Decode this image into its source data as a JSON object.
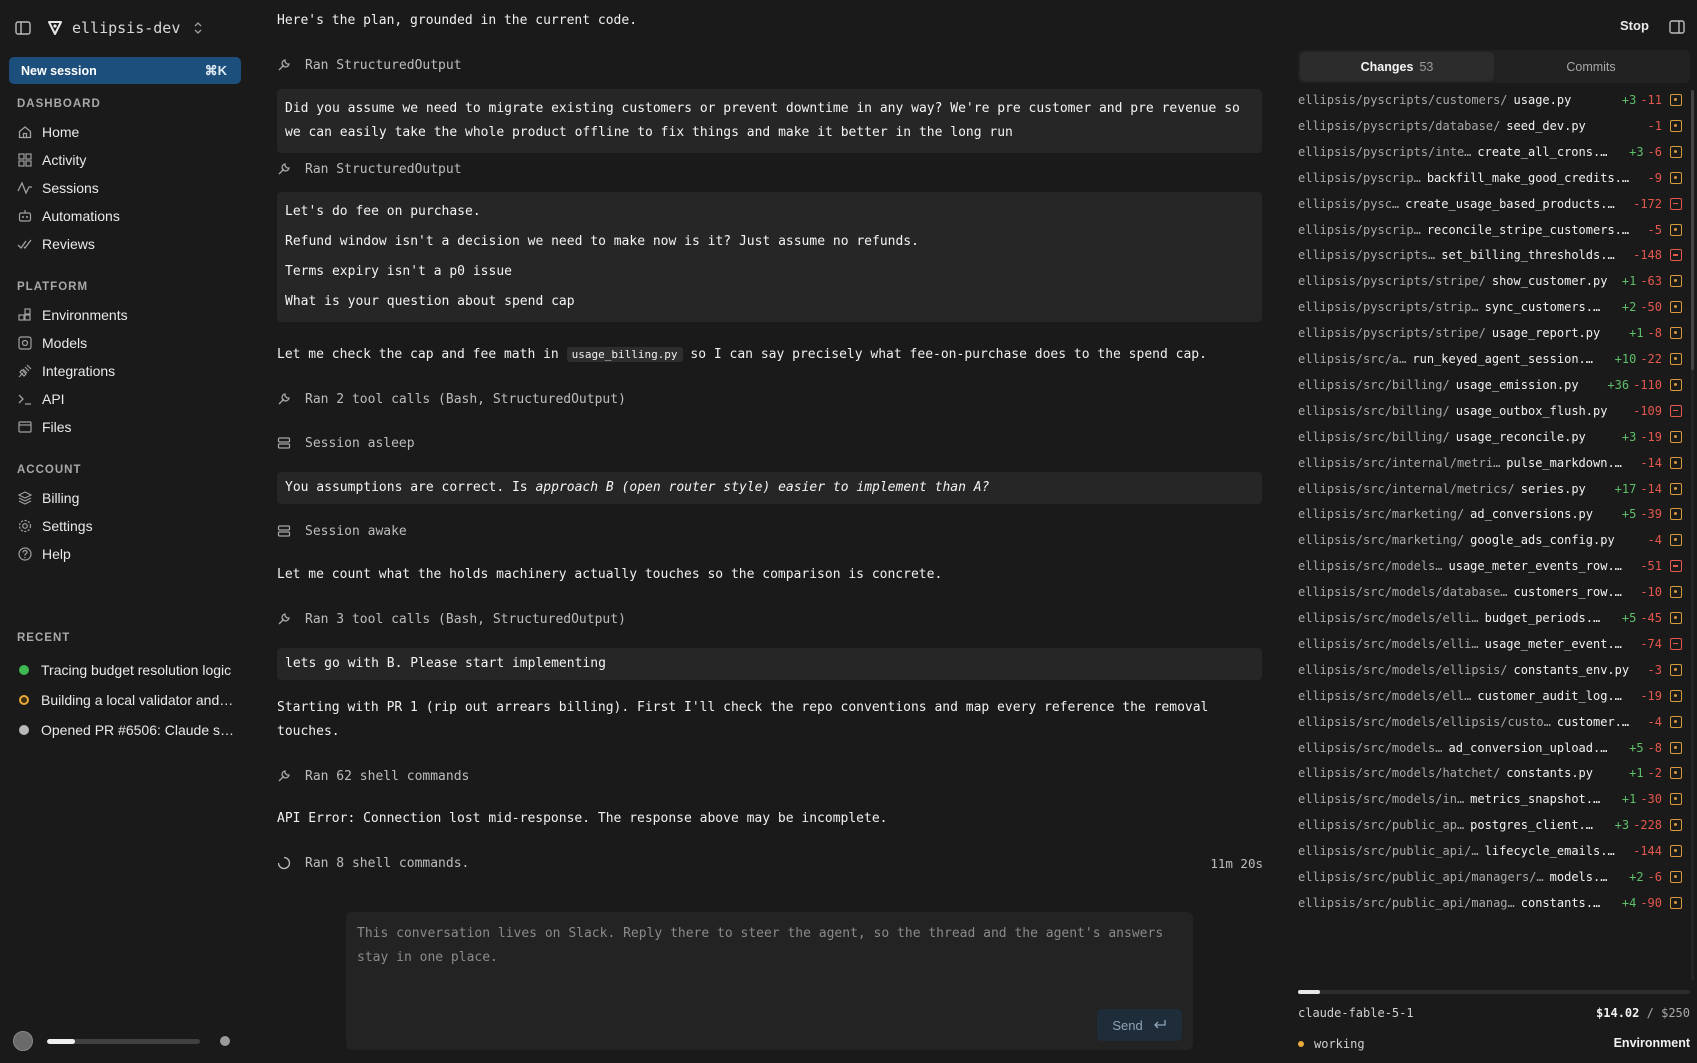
{
  "workspace": {
    "name": "ellipsis-dev"
  },
  "new_session": {
    "label": "New session",
    "shortcut": "⌘K"
  },
  "sidebar": {
    "dashboard_title": "DASHBOARD",
    "dashboard": [
      {
        "label": "Home",
        "icon": "home-icon"
      },
      {
        "label": "Activity",
        "icon": "grid-icon"
      },
      {
        "label": "Sessions",
        "icon": "pulse-icon"
      },
      {
        "label": "Automations",
        "icon": "robot-icon"
      },
      {
        "label": "Reviews",
        "icon": "check-double-icon"
      }
    ],
    "platform_title": "PLATFORM",
    "platform": [
      {
        "label": "Environments",
        "icon": "blocks-icon"
      },
      {
        "label": "Models",
        "icon": "model-icon"
      },
      {
        "label": "Integrations",
        "icon": "plug-icon"
      },
      {
        "label": "API",
        "icon": "terminal-icon"
      },
      {
        "label": "Files",
        "icon": "files-icon"
      }
    ],
    "account_title": "ACCOUNT",
    "account": [
      {
        "label": "Billing",
        "icon": "layers-icon"
      },
      {
        "label": "Settings",
        "icon": "gear-icon"
      },
      {
        "label": "Help",
        "icon": "help-icon"
      }
    ],
    "recent_title": "RECENT",
    "recent": [
      {
        "label": "Tracing budget resolution logic",
        "color": "#3fb950"
      },
      {
        "label": "Building a local validator and…",
        "color": "#e8a93a"
      },
      {
        "label": "Opened PR #6506: Claude s…",
        "color": "#b9b9b9"
      }
    ],
    "usage_fraction": 0.18
  },
  "header": {
    "stop_label": "Stop"
  },
  "chat": {
    "intro": "Here's the plan, grounded in the current code.",
    "tool1": "Ran StructuredOutput",
    "user1": "Did you assume we need to migrate existing customers or prevent downtime in any way? We're pre customer and pre revenue so we can easily take the whole product offline to fix things and make it better in the long run",
    "tool2": "Ran StructuredOutput",
    "user2": [
      "Let's do fee on purchase.",
      "Refund window isn't a decision we need to make now is it? Just assume no refunds.",
      "Terms expiry isn't a p0 issue",
      "What is your question about spend cap"
    ],
    "assistant1_pre": "Let me check the cap and fee math in",
    "assistant1_code": "usage_billing.py",
    "assistant1_post": "so I can say precisely what fee-on-purchase does to the spend cap.",
    "tool3": "Ran 2 tool calls (Bash, StructuredOutput)",
    "event1": "Session asleep",
    "user3_pre": "You assumptions are correct. Is",
    "user3_em": "approach B (open router style) easier to implement than A?",
    "event2": "Session awake",
    "assistant2": "Let me count what the holds machinery actually touches so the comparison is concrete.",
    "tool4": "Ran 3 tool calls (Bash, StructuredOutput)",
    "user4": "lets go with B. Please start implementing",
    "assistant3": "Starting with PR 1 (rip out arrears billing). First I'll check the repo conventions and map every reference the removal touches.",
    "tool5": "Ran 62 shell commands",
    "error": "API Error: Connection lost mid-response. The response above may be incomplete.",
    "running": "Ran 8 shell commands.",
    "timer": "11m 20s"
  },
  "composer": {
    "placeholder": "This conversation lives on Slack. Reply there to steer the agent, so the thread and the agent's answers stay in one place.",
    "send_label": "Send"
  },
  "panel": {
    "tab_changes": "Changes",
    "tab_changes_count": "53",
    "tab_commits": "Commits",
    "files": [
      {
        "path": "ellipsis/pyscripts/customers/",
        "name": "usage.py",
        "add": "+3",
        "del": "-11",
        "status": "modified"
      },
      {
        "path": "ellipsis/pyscripts/database/",
        "name": "seed_dev.py",
        "add": "",
        "del": "-1",
        "status": "modified"
      },
      {
        "path": "ellipsis/pyscripts/inte…",
        "name": "create_all_crons.…",
        "add": "+3",
        "del": "-6",
        "status": "modified"
      },
      {
        "path": "ellipsis/pyscrip…",
        "name": "backfill_make_good_credits.…",
        "add": "",
        "del": "-9",
        "status": "modified"
      },
      {
        "path": "ellipsis/pysc…",
        "name": "create_usage_based_products.…",
        "add": "",
        "del": "-172",
        "status": "removed"
      },
      {
        "path": "ellipsis/pyscrip…",
        "name": "reconcile_stripe_customers.…",
        "add": "",
        "del": "-5",
        "status": "modified"
      },
      {
        "path": "ellipsis/pyscripts…",
        "name": "set_billing_thresholds.…",
        "add": "",
        "del": "-148",
        "status": "removed"
      },
      {
        "path": "ellipsis/pyscripts/stripe/",
        "name": "show_customer.py",
        "add": "+1",
        "del": "-63",
        "status": "modified"
      },
      {
        "path": "ellipsis/pyscripts/strip…",
        "name": "sync_customers.…",
        "add": "+2",
        "del": "-50",
        "status": "modified"
      },
      {
        "path": "ellipsis/pyscripts/stripe/",
        "name": "usage_report.py",
        "add": "+1",
        "del": "-8",
        "status": "modified"
      },
      {
        "path": "ellipsis/src/a…",
        "name": "run_keyed_agent_session.…",
        "add": "+10",
        "del": "-22",
        "status": "modified"
      },
      {
        "path": "ellipsis/src/billing/",
        "name": "usage_emission.py",
        "add": "+36",
        "del": "-110",
        "status": "modified"
      },
      {
        "path": "ellipsis/src/billing/",
        "name": "usage_outbox_flush.py",
        "add": "",
        "del": "-109",
        "status": "removed"
      },
      {
        "path": "ellipsis/src/billing/",
        "name": "usage_reconcile.py",
        "add": "+3",
        "del": "-19",
        "status": "modified"
      },
      {
        "path": "ellipsis/src/internal/metri…",
        "name": "pulse_markdown.…",
        "add": "",
        "del": "-14",
        "status": "modified"
      },
      {
        "path": "ellipsis/src/internal/metrics/",
        "name": "series.py",
        "add": "+17",
        "del": "-14",
        "status": "modified"
      },
      {
        "path": "ellipsis/src/marketing/",
        "name": "ad_conversions.py",
        "add": "+5",
        "del": "-39",
        "status": "modified"
      },
      {
        "path": "ellipsis/src/marketing/",
        "name": "google_ads_config.py",
        "add": "",
        "del": "-4",
        "status": "modified"
      },
      {
        "path": "ellipsis/src/models…",
        "name": "usage_meter_events_row.…",
        "add": "",
        "del": "-51",
        "status": "removed"
      },
      {
        "path": "ellipsis/src/models/database…",
        "name": "customers_row.…",
        "add": "",
        "del": "-10",
        "status": "modified"
      },
      {
        "path": "ellipsis/src/models/elli…",
        "name": "budget_periods.…",
        "add": "+5",
        "del": "-45",
        "status": "modified"
      },
      {
        "path": "ellipsis/src/models/elli…",
        "name": "usage_meter_event.…",
        "add": "",
        "del": "-74",
        "status": "removed"
      },
      {
        "path": "ellipsis/src/models/ellipsis/",
        "name": "constants_env.py",
        "add": "",
        "del": "-3",
        "status": "modified"
      },
      {
        "path": "ellipsis/src/models/ell…",
        "name": "customer_audit_log.…",
        "add": "",
        "del": "-19",
        "status": "modified"
      },
      {
        "path": "ellipsis/src/models/ellipsis/custo…",
        "name": "customer.…",
        "add": "",
        "del": "-4",
        "status": "modified"
      },
      {
        "path": "ellipsis/src/models…",
        "name": "ad_conversion_upload.…",
        "add": "+5",
        "del": "-8",
        "status": "modified"
      },
      {
        "path": "ellipsis/src/models/hatchet/",
        "name": "constants.py",
        "add": "+1",
        "del": "-2",
        "status": "modified"
      },
      {
        "path": "ellipsis/src/models/in…",
        "name": "metrics_snapshot.…",
        "add": "+1",
        "del": "-30",
        "status": "modified"
      },
      {
        "path": "ellipsis/src/public_ap…",
        "name": "postgres_client.…",
        "add": "+3",
        "del": "-228",
        "status": "modified"
      },
      {
        "path": "ellipsis/src/public_api/…",
        "name": "lifecycle_emails.…",
        "add": "",
        "del": "-144",
        "status": "modified"
      },
      {
        "path": "ellipsis/src/public_api/managers/…",
        "name": "models.…",
        "add": "+2",
        "del": "-6",
        "status": "modified"
      },
      {
        "path": "ellipsis/src/public_api/manag…",
        "name": "constants.…",
        "add": "+4",
        "del": "-90",
        "status": "modified"
      }
    ],
    "model": "claude-fable-5-1",
    "cost_spent": "$14.02",
    "cost_sep": "/",
    "cost_limit": "$250",
    "status": "working",
    "env_label": "Environment"
  },
  "colors": {
    "accent": "#1d4f7c",
    "add": "#5fbf6a",
    "del": "#e4584d",
    "modified": "#d79b3a"
  }
}
